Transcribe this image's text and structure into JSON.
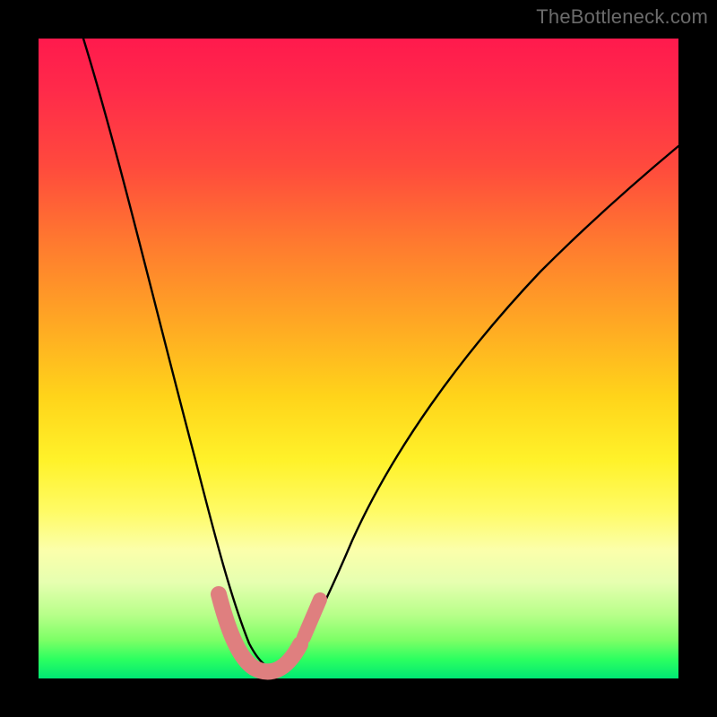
{
  "watermark": {
    "text": "TheBottleneck.com"
  },
  "chart_data": {
    "type": "line",
    "title": "",
    "xlabel": "",
    "ylabel": "",
    "xlim": [
      0,
      100
    ],
    "ylim": [
      0,
      100
    ],
    "grid": false,
    "legend": false,
    "notes": "Values are read in percent of the plot area. y=0 is the bottom (green), y=100 is the top (red). Curve resembles a bottleneck dip with minimum near x≈33–37.",
    "series": [
      {
        "name": "bottleneck-curve",
        "color": "#000000",
        "x": [
          7,
          10,
          13,
          16,
          19,
          22,
          24,
          26,
          28,
          30,
          32,
          34,
          36,
          38,
          40,
          43,
          47,
          52,
          58,
          65,
          73,
          82,
          92,
          100
        ],
        "y": [
          100,
          88,
          76,
          64,
          53,
          42,
          33,
          25,
          18,
          12,
          7,
          4,
          3,
          4,
          7,
          12,
          19,
          27,
          36,
          45,
          54,
          62,
          70,
          76
        ]
      },
      {
        "name": "highlight-band",
        "color": "#e08080",
        "shape": "thick-stroke",
        "x": [
          28,
          30,
          32,
          34,
          36,
          38,
          40
        ],
        "y": [
          13,
          8,
          5,
          3.5,
          3.5,
          5,
          9
        ]
      }
    ]
  }
}
